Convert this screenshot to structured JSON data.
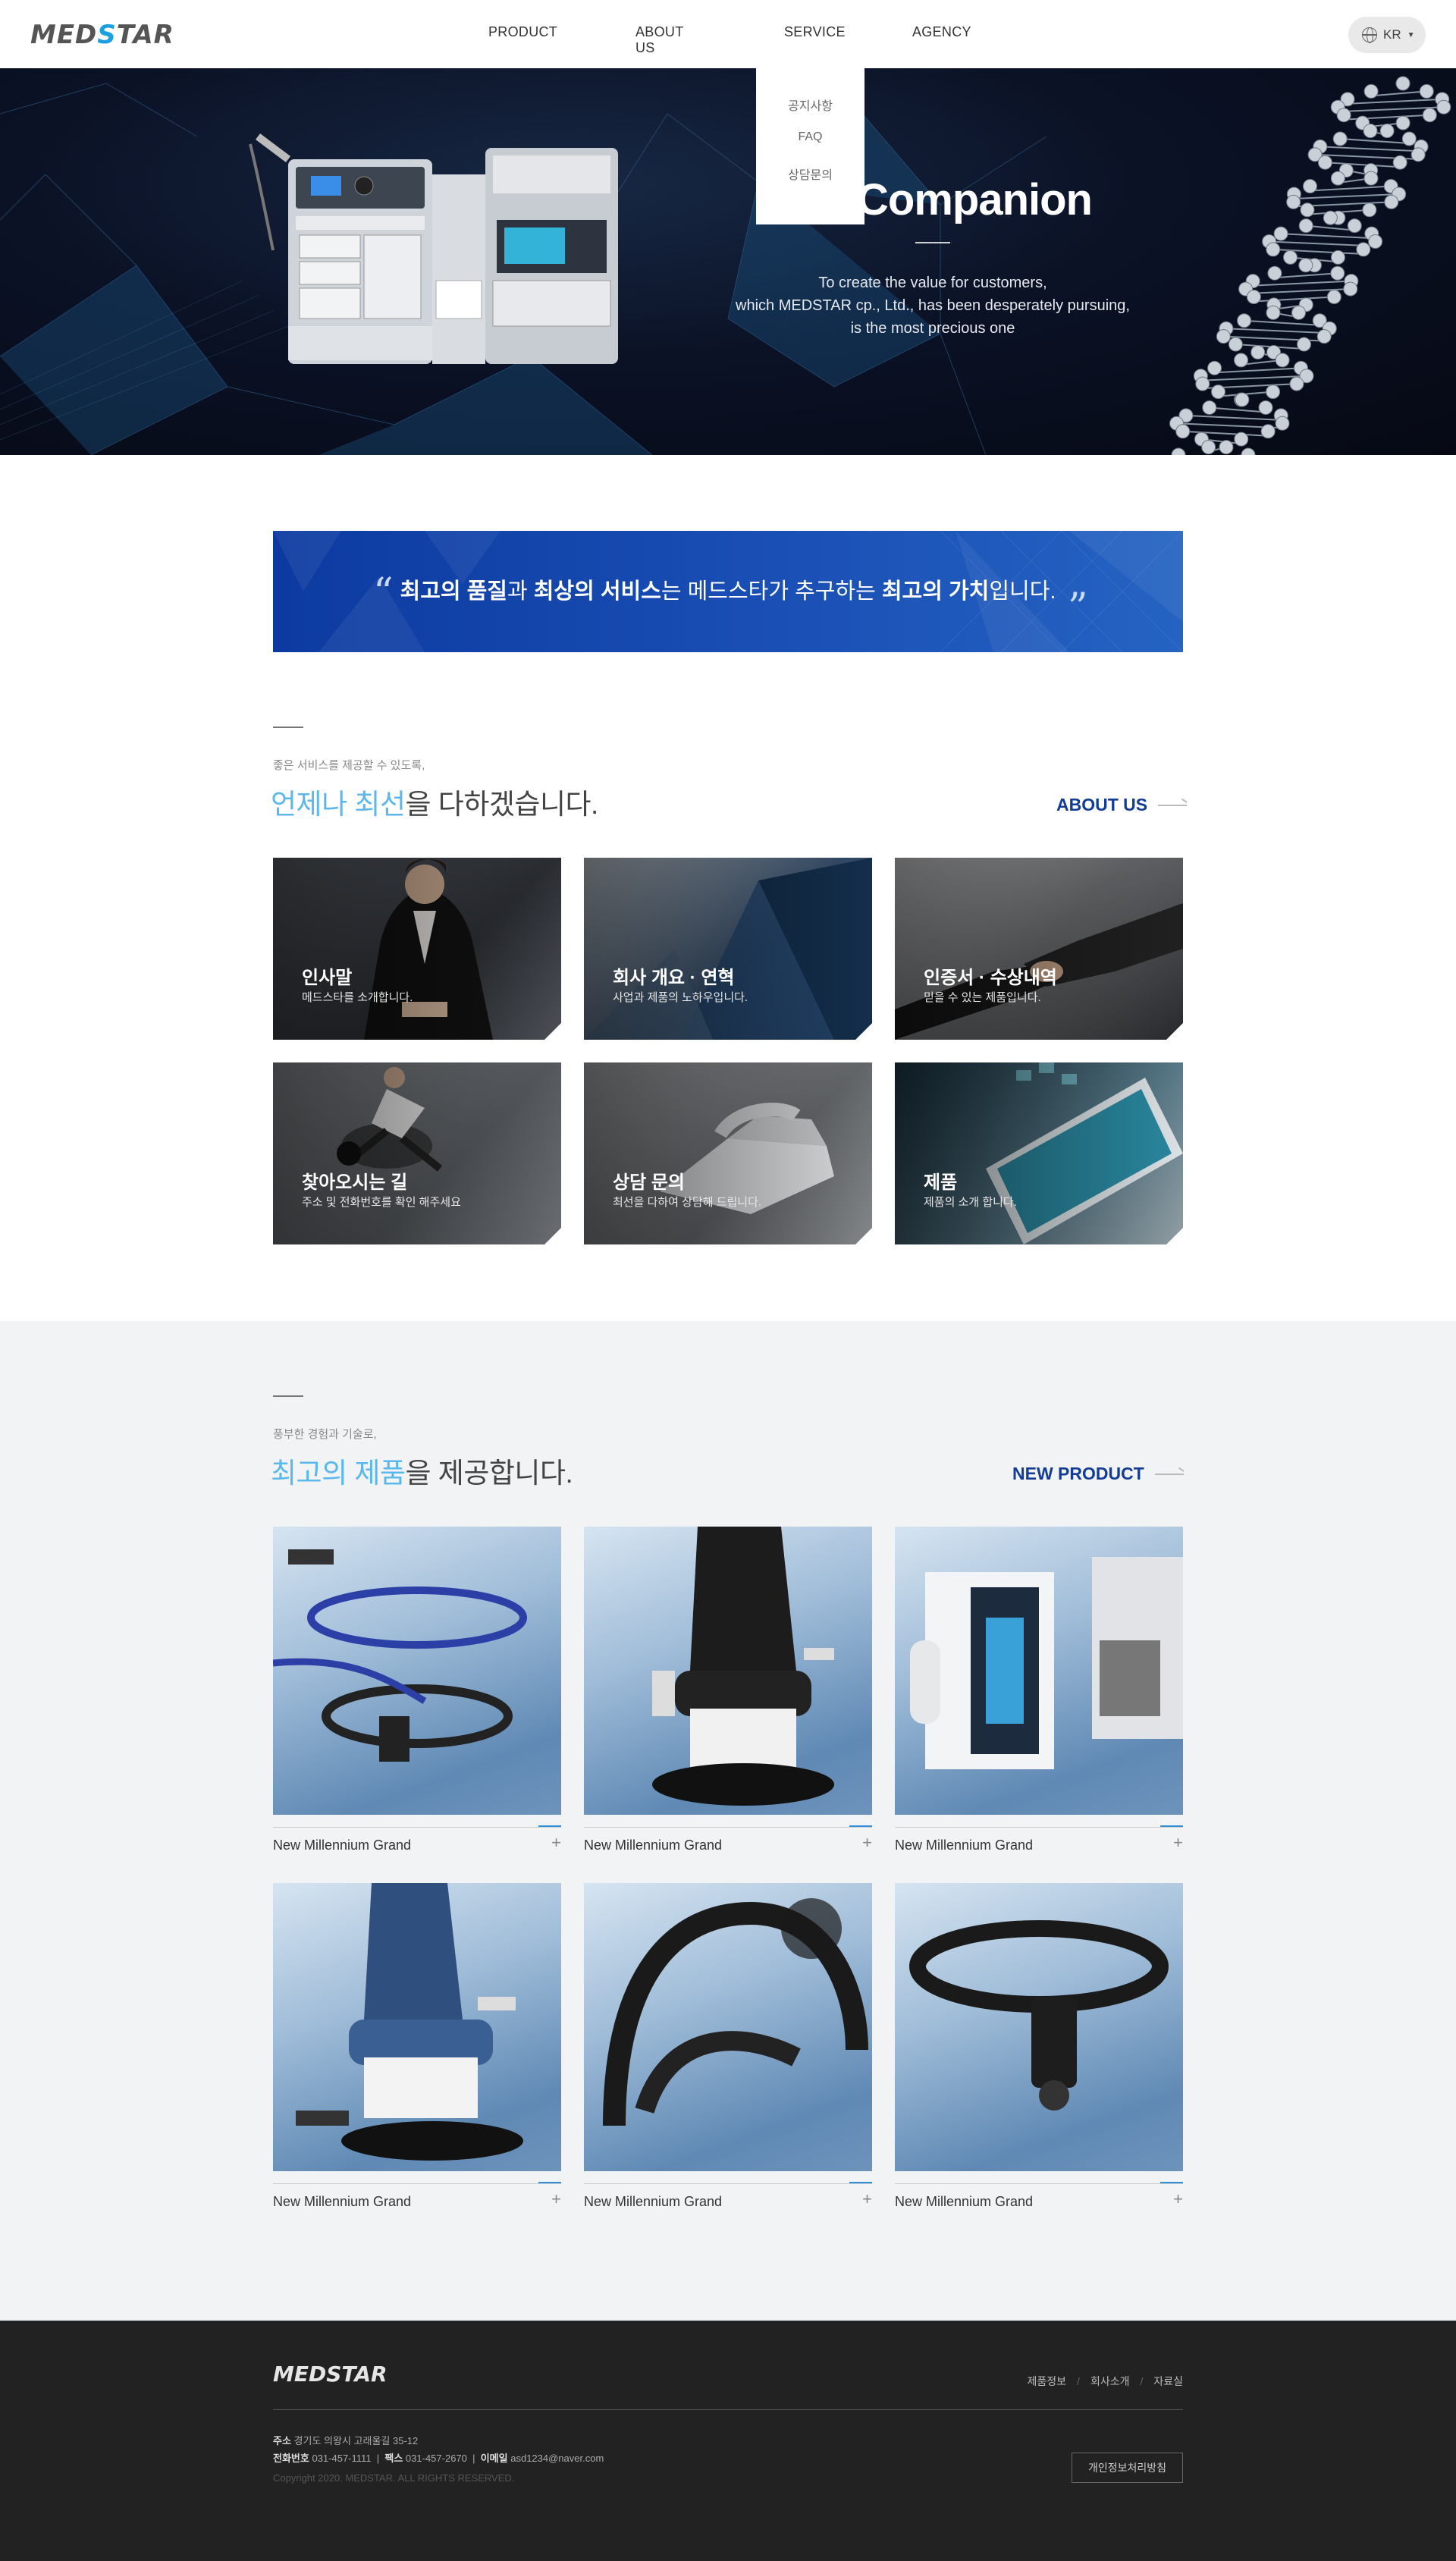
{
  "header": {
    "logo": "MEDSTAR",
    "nav": [
      "PRODUCT",
      "ABOUT US",
      "SERVICE",
      "AGENCY"
    ],
    "lang": "KR",
    "service_dropdown": [
      "공지사항",
      "FAQ",
      "상담문의"
    ]
  },
  "hero": {
    "title": "Companion",
    "lines": [
      "To create the value for customers,",
      "which MEDSTAR cp., Ltd., has been desperately pursuing,",
      "is the most precious one"
    ]
  },
  "quote": {
    "open": "“",
    "close": "”",
    "p1": "최고의 품질",
    "p2": "과 ",
    "p3": "최상의 서비스",
    "p4": "는 메드스타가 추구하는 ",
    "p5": "최고의 가치",
    "p6": "입니다."
  },
  "about": {
    "sub": "좋은 서비스를 제공할 수 있도록,",
    "title_hl": "언제나 최선",
    "title_rest": "을 다하겠습니다.",
    "more": "ABOUT US",
    "cards": [
      {
        "title": "인사말",
        "sub": "메드스타를 소개합니다."
      },
      {
        "title": "회사 개요 · 연혁",
        "sub": "사업과 제품의 노하우입니다."
      },
      {
        "title": "인증서 · 수상내역",
        "sub": "믿을 수 있는 제품입니다."
      },
      {
        "title": "찾아오시는 길",
        "sub": "주소 및 전화번호를 확인 해주세요"
      },
      {
        "title": "상담 문의",
        "sub": "최선을 다하여 상담해 드립니다."
      },
      {
        "title": "제품",
        "sub": "제품의 소개 합니다."
      }
    ]
  },
  "products": {
    "sub": "풍부한 경험과 기술로,",
    "title_hl": "최고의 제품",
    "title_rest": "을 제공합니다.",
    "more": "NEW PRODUCT",
    "items": [
      {
        "name": "New Millennium Grand"
      },
      {
        "name": "New Millennium Grand"
      },
      {
        "name": "New Millennium Grand"
      },
      {
        "name": "New Millennium Grand"
      },
      {
        "name": "New Millennium Grand"
      },
      {
        "name": "New Millennium Grand"
      }
    ],
    "plus": "+"
  },
  "footer": {
    "logo": "MEDSTAR",
    "links": [
      "제품정보",
      "회사소개",
      "자료실"
    ],
    "address_label": "주소",
    "address": "경기도 의왕시 고래울길 35-12",
    "phone_label": "전화번호",
    "phone": "031-457-1111",
    "fax_label": "팩스",
    "fax": "031-457-2670",
    "email_label": "이메일",
    "email": "asd1234@naver.com",
    "copyright": "Copyright 2020. MEDSTAR. ALL RIGHTS RESERVED.",
    "privacy_button": "개인정보처리방침"
  }
}
